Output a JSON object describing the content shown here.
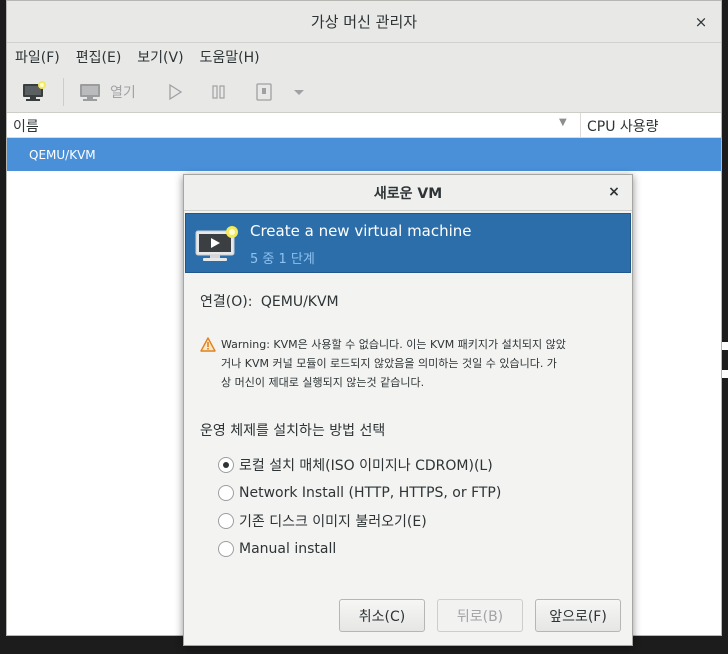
{
  "window": {
    "title": "가상 머신 관리자",
    "close_glyph": "×"
  },
  "menubar": {
    "items": [
      {
        "label": "파일(F)"
      },
      {
        "label": "편집(E)"
      },
      {
        "label": "보기(V)"
      },
      {
        "label": "도움말(H)"
      }
    ]
  },
  "toolbar": {
    "open_label": "열기"
  },
  "vm_list": {
    "columns": [
      "이름",
      "CPU 사용량"
    ],
    "rows": [
      {
        "name": "QEMU/KVM"
      }
    ]
  },
  "dialog": {
    "title": "새로운 VM",
    "close_glyph": "×",
    "banner_title": "Create a new virtual machine",
    "banner_step": "5 중 1 단계",
    "connection_label": "연결(O):",
    "connection_value": "QEMU/KVM",
    "warning_text": "Warning: KVM은 사용할 수 없습니다. 이는 KVM 패키지가 설치되지 않았거나 KVM 커널 모듈이 로드되지 않았음을 의미하는 것일 수 있습니다. 가상 머신이 제대로 실행되지 않는것 같습니다.",
    "warning_lines": [
      "Warning: KVM은 사용할 수 없습니다. 이는 KVM 패키지가 설치되지 않았",
      "거나 KVM 커널 모듈이 로드되지 않았음을 의미하는 것일 수 있습니다. 가",
      "상 머신이 제대로 실행되지 않는것 같습니다."
    ],
    "install_method_label": "운영 체제를 설치하는 방법 선택",
    "install_options": [
      {
        "label": "로컬 설치 매체(ISO 이미지나 CDROM)(L)",
        "checked": true
      },
      {
        "label": "Network Install (HTTP, HTTPS, or FTP)",
        "checked": false
      },
      {
        "label": "기존 디스크 이미지 불러오기(E)",
        "checked": false
      },
      {
        "label": "Manual install",
        "checked": false
      }
    ],
    "buttons": {
      "cancel": "취소(C)",
      "back": "뒤로(B)",
      "forward": "앞으로(F)"
    }
  },
  "colors": {
    "selection": "#4a90d9",
    "banner": "#2b6ea9",
    "banner_step": "#8ec2f0",
    "warning": "#e0821e"
  },
  "icons": [
    "new-vm-icon",
    "open-console-icon",
    "run-icon",
    "pause-icon",
    "shutdown-icon",
    "dropdown-icon",
    "sort-down-icon",
    "vm-monitor-icon",
    "warning-icon"
  ]
}
